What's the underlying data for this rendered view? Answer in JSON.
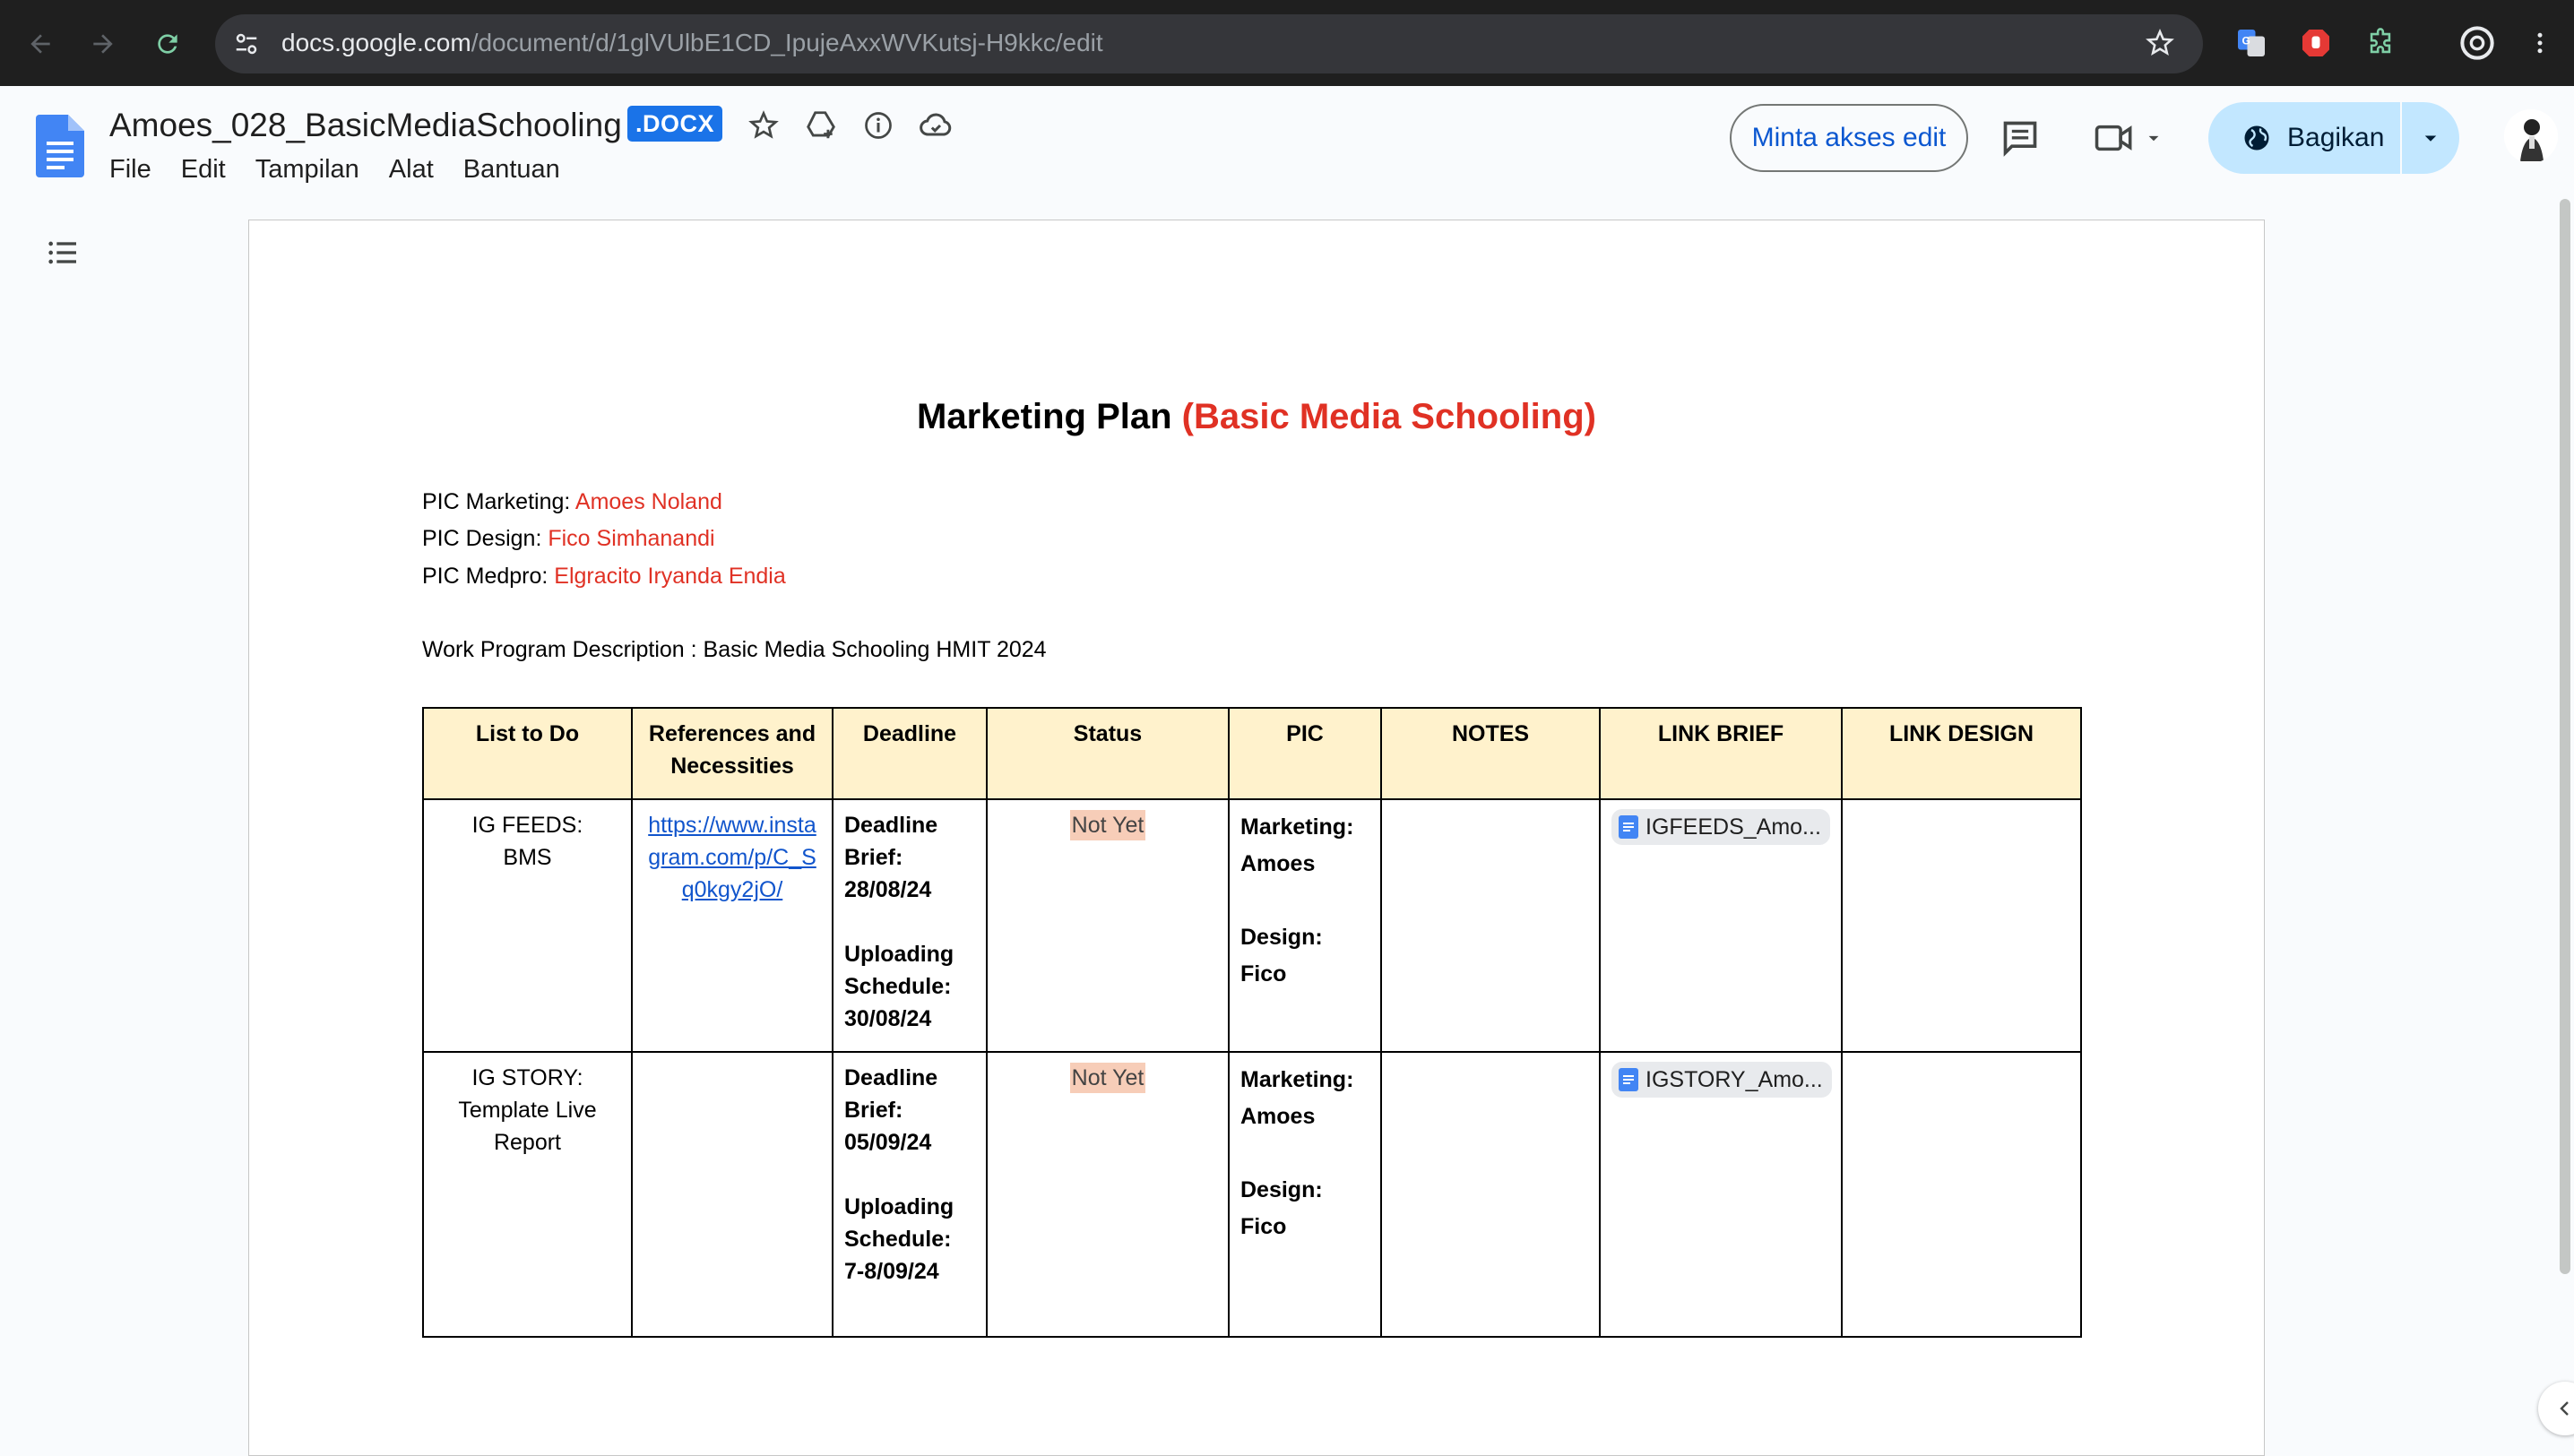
{
  "browser": {
    "url_host": "docs.google.com",
    "url_path": "/document/d/1glVUlbE1CD_IpujeAxxWVKutsj-H9kkc/edit"
  },
  "docs": {
    "title": "Amoes_028_BasicMediaSchooling",
    "file_badge": ".DOCX",
    "menu": [
      "File",
      "Edit",
      "Tampilan",
      "Alat",
      "Bantuan"
    ],
    "edit_access_label": "Minta akses edit",
    "share_label": "Bagikan"
  },
  "document": {
    "heading_main": "Marketing Plan ",
    "heading_accent": "(Basic Media Schooling)",
    "pic_marketing_label": "PIC Marketing: ",
    "pic_marketing_value": "Amoes Noland",
    "pic_design_label": "PIC Design: ",
    "pic_design_value": "Fico Simhanandi",
    "pic_medpro_label": "PIC Medpro: ",
    "pic_medpro_value": "Elgracito Iryanda Endia",
    "work_program": "Work Program Description : Basic Media Schooling HMIT 2024",
    "table": {
      "headers": [
        "List to Do",
        "References and Necessities",
        "Deadline",
        "Status",
        "PIC",
        "NOTES",
        "LINK BRIEF",
        "LINK DESIGN"
      ],
      "rows": [
        {
          "list_line1": "IG FEEDS:",
          "list_line2": "BMS",
          "list_line3": "",
          "reference": "https://www.instagram.com/p/C_Sq0kgy2jO/",
          "deadline_label1": "Deadline",
          "deadline_label2": "Brief:",
          "deadline_brief": "28/08/24",
          "upload_label1": "Uploading",
          "upload_label2": "Schedule:",
          "upload_date": "30/08/24",
          "status": "Not Yet",
          "pic_marketing_label": "Marketing:",
          "pic_marketing": "Amoes",
          "pic_design_label": "Design:",
          "pic_design": "Fico",
          "notes": "",
          "link_brief": "IGFEEDS_Amo...",
          "link_design": ""
        },
        {
          "list_line1": "IG STORY:",
          "list_line2": "Template Live",
          "list_line3": "Report",
          "reference": "",
          "deadline_label1": "Deadline",
          "deadline_label2": "Brief:",
          "deadline_brief": "05/09/24",
          "upload_label1": "Uploading",
          "upload_label2": "Schedule:",
          "upload_date": "7-8/09/24",
          "status": "Not Yet",
          "pic_marketing_label": "Marketing:",
          "pic_marketing": "Amoes",
          "pic_design_label": "Design:",
          "pic_design": "Fico",
          "notes": "",
          "link_brief": "IGSTORY_Amo...",
          "link_design": ""
        }
      ]
    }
  },
  "icons": {
    "back": "arrow-left-icon",
    "forward": "arrow-right-icon",
    "reload": "reload-icon",
    "site_info": "tune-icon",
    "bookmark": "star-icon",
    "translate": "google-translate-icon",
    "adblock": "stop-hand-icon",
    "extensions": "puzzle-icon",
    "profile": "profile-ring-icon",
    "menu": "kebab-icon",
    "docs_logo": "docs-logo-icon",
    "outline": "list-icon"
  },
  "colors": {
    "accent_red": "#e03124",
    "header_fill": "#fff2cc",
    "status_fill": "#f7cdb8",
    "share_fill": "#c2e7ff",
    "link_blue": "#1155cc"
  }
}
